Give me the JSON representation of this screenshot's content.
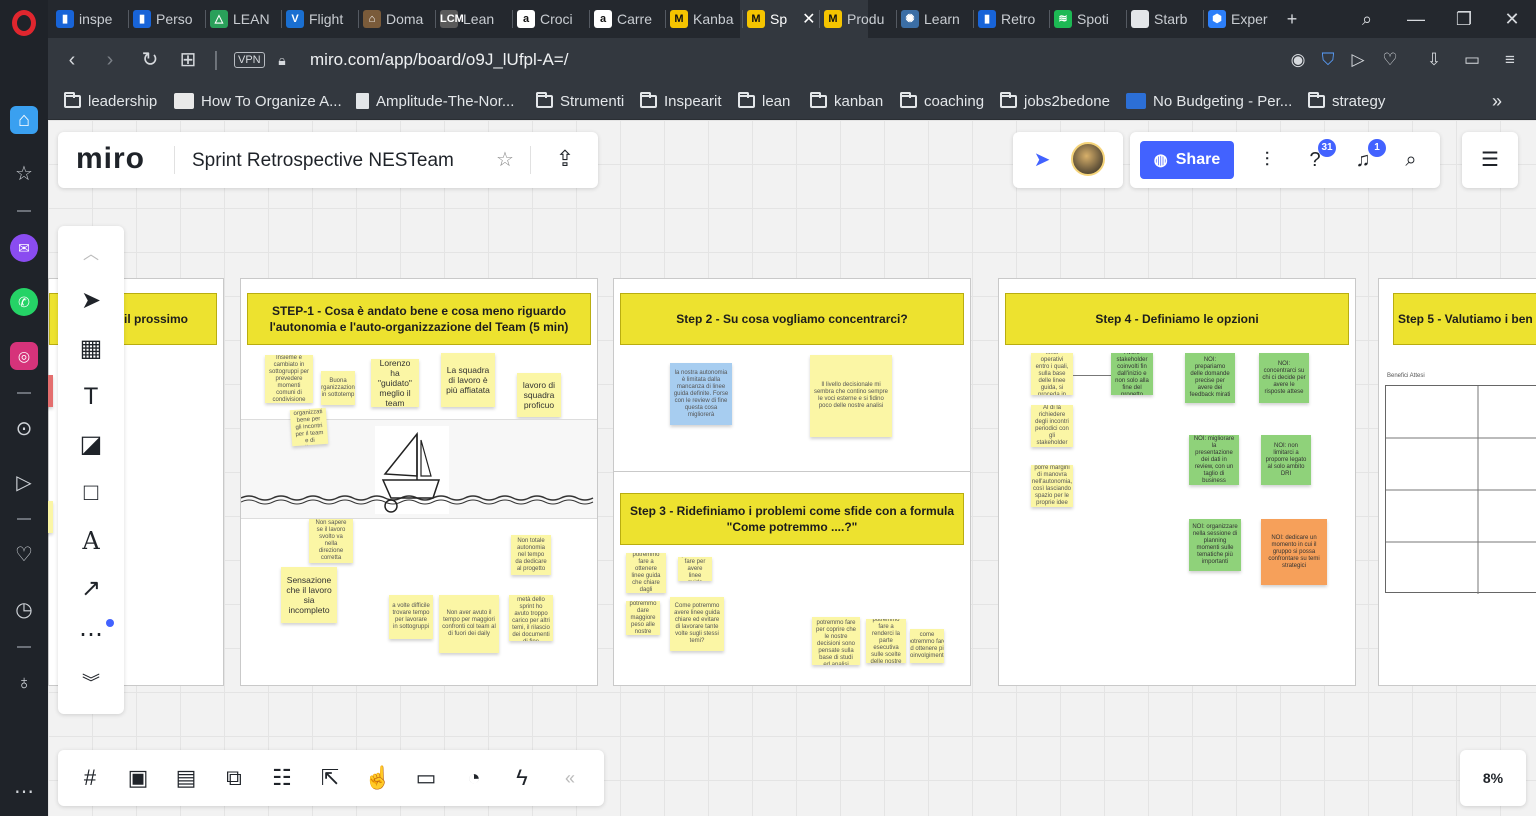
{
  "browser": {
    "tabs": [
      {
        "label": "inspe",
        "color": "#1864d8",
        "glyph": "▮"
      },
      {
        "label": "Perso",
        "color": "#1864d8",
        "glyph": "▮"
      },
      {
        "label": "LEAN",
        "color": "#2aa05a",
        "glyph": "△"
      },
      {
        "label": "Flight",
        "color": "#1a6fd1",
        "glyph": "V"
      },
      {
        "label": "Doma",
        "color": "#7a5b3a",
        "glyph": "⌂"
      },
      {
        "label": "Lean",
        "color": "#5a5a5a",
        "glyph": "LCM"
      },
      {
        "label": "Croci",
        "color": "#ffffff",
        "glyph": "a"
      },
      {
        "label": "Carre",
        "color": "#ffffff",
        "glyph": "a"
      },
      {
        "label": "Kanba",
        "color": "#f5c400",
        "glyph": "M"
      },
      {
        "label": "Sp",
        "color": "#f5c400",
        "glyph": "M",
        "active": true
      },
      {
        "label": "Produ",
        "color": "#f5c400",
        "glyph": "M"
      },
      {
        "label": "Learn",
        "color": "#3b6ea5",
        "glyph": "✺"
      },
      {
        "label": "Retro",
        "color": "#1864d8",
        "glyph": "▮"
      },
      {
        "label": "Spoti",
        "color": "#1db954",
        "glyph": "≋"
      },
      {
        "label": "Starb",
        "color": "#e3e6e9",
        "glyph": ""
      },
      {
        "label": "Exper",
        "color": "#2d7ff9",
        "glyph": "⬢"
      }
    ],
    "new_tab": "+",
    "url": "miro.com/app/board/o9J_lUfpl-A=/",
    "vpn_label": "VPN",
    "bookmarks": [
      {
        "label": "leadership",
        "type": "folder"
      },
      {
        "label": "How To Organize A...",
        "type": "image"
      },
      {
        "label": "Amplitude-The-Nor...",
        "type": "doc"
      },
      {
        "label": "Strumenti",
        "type": "folder"
      },
      {
        "label": "Inspearit",
        "type": "folder"
      },
      {
        "label": "lean",
        "type": "folder"
      },
      {
        "label": "kanban",
        "type": "folder"
      },
      {
        "label": "coaching",
        "type": "folder"
      },
      {
        "label": "jobs2bedone",
        "type": "folder"
      },
      {
        "label": "No Budgeting - Per...",
        "type": "image"
      },
      {
        "label": "strategy",
        "type": "folder"
      }
    ]
  },
  "miro": {
    "logo": "miro",
    "board_title": "Sprint Retrospective NESTeam",
    "share_label": "Share",
    "help_badge": "31",
    "notif_badge": "1",
    "zoom": "8%",
    "colors": {
      "accent": "#4262ff",
      "sticky_yellow": "#fbf6a5",
      "frame_title": "#ede22f"
    }
  },
  "frames": {
    "prev_title": "il prossimo",
    "step1_title": "STEP-1 - Cosa è andato bene e cosa meno riguardo l'autonomia e l'auto-organizzazione del Team (5 min)",
    "step2_title": "Step 2 - Su cosa vogliamo concentrarci?",
    "step3_title": "Step 3 - Ridefiniamo i problemi come sfide con a formula \"Come potremmo ....?\"",
    "step4_title": "Step 4 - Definiamo le opzioni",
    "step5_title": "Step 5 - Valutiamo i ben",
    "step5_table_label": "Benefici Attesi"
  },
  "notes": {
    "s1_a": "Insieme è cambiato in sottogruppi per prevedere momenti comuni di condivisione",
    "s1_b": "Buona organizzazione in sottotemp",
    "s1_c": "Lorenzo ha \"guidato\" meglio il team",
    "s1_d": "La squadra di lavoro è più affiatata",
    "s1_e": "lavoro di squadra proficuo",
    "s1_f": "Siamo più organizzati bene per gli incontri per il team e di sviluppo",
    "s1_g": "Non sapere se il lavoro svolto va nella direzione corretta",
    "s1_h": "Sensazione che il lavoro sia incompleto",
    "s1_i": "a volte difficile trovare tempo per lavorare in sottogruppi",
    "s1_j": "Non aver avuto il tempo per maggiori confronti col team al di fuori dei daily",
    "s1_k": "Non totale autonomia nel tempo da dedicare al progetto",
    "s1_l": "dalla seconda metà dello sprint ho avuto troppo carico per altri temi, il rilascio dei documenti di fine",
    "s2_a": "la nostra autonomia è limitata dalla mancanza di linee guida definite. Forse con le review di fine questa cosa migliorerà",
    "s2_b": "Il livello decisionale mi sembra che contino sempre le voci esterne e si fidino poco delle nostre analisi",
    "s3_a": "come potremmo fare a ottenere linee guida che chiare dagli stakeholder",
    "s3_b": "come potremmo fare per avere linee guida precise",
    "s3_c": "come potremmo dare maggiore peso alle nostre decisioni",
    "s3_d": "Come potremmo avere linee guida chiare ed evitare di lavorare tante volte sugli stessi temi?",
    "s3_e": "come potremmo fare per coprire che le nostre decisioni sono pensate sulla base di studi ed analisi",
    "s3_f": "come potremmo fare a renderci la parte esecutiva sulle scelte delle nostre analisi",
    "s3_g": "come potremmo fare ad ottenere più coinvolgimento",
    "s4_a": "Decidere dei limiti operativi entro i quali, sulla base delle linee guida, si proceda in autonomia",
    "s4_b": "Avere stakeholder coinvolti fin dall'inizio e non solo alla fine del progetto",
    "s4_c": "NOI: prepariamo delle domande precise per avere dei feedback mirati",
    "s4_d": "NOI: concentrarci su chi ci decide per avere le risposte attese",
    "s4_e": "Al di là richiedere degli incontri periodici con gli stakeholder",
    "s4_f": "porre margini di manovra nell'autonomia, così lasciando spazio per le proprie idee",
    "s4_g": "NOI: migliorare la presentazione dei dati in review, con un taglio di business",
    "s4_h": "NOI: non limitarci a proporre legato al solo ambito DRI",
    "s4_i": "NOI: organizzare nella sessione di planning momenti sulle tematiche più importanti",
    "s4_j": "NOI: dedicare un momento in cui il gruppo si possa confrontare su temi strategici"
  },
  "toolbar": {
    "tools": [
      {
        "name": "collapse-up-icon",
        "glyph": "⌃"
      },
      {
        "name": "select-icon",
        "glyph": "➤"
      },
      {
        "name": "templates-icon",
        "glyph": "▦"
      },
      {
        "name": "text-icon",
        "glyph": "T"
      },
      {
        "name": "sticky-note-icon",
        "glyph": "◪"
      },
      {
        "name": "shape-icon",
        "glyph": "□"
      },
      {
        "name": "pen-icon",
        "glyph": "A"
      },
      {
        "name": "arrow-icon",
        "glyph": "↗"
      },
      {
        "name": "more-tools-icon",
        "glyph": "⋯"
      },
      {
        "name": "collapse-down-icon",
        "glyph": "⌄"
      }
    ]
  }
}
